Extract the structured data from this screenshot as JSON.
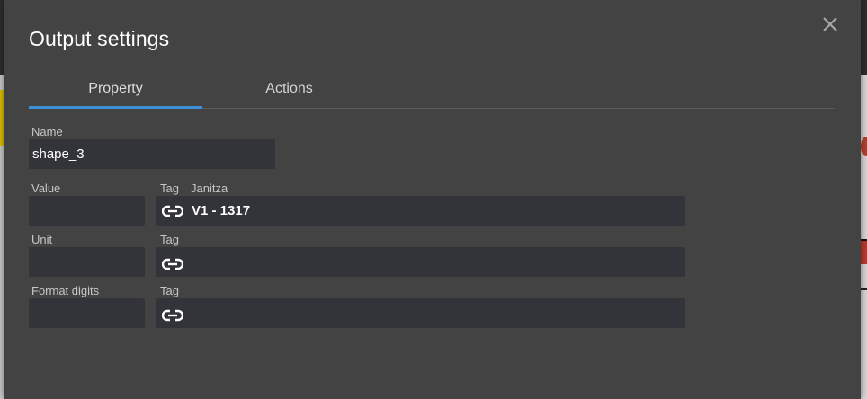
{
  "dialog": {
    "title": "Output settings",
    "close_icon": "close-icon"
  },
  "tabs": [
    {
      "label": "Property",
      "active": true
    },
    {
      "label": "Actions",
      "active": false
    }
  ],
  "accent_color": "#3d8fd6",
  "form": {
    "name": {
      "label": "Name",
      "value": "shape_3"
    },
    "rows": [
      {
        "label": "Value",
        "value": "",
        "tag_label": "Tag",
        "tag_source": "Janitza",
        "tag_value": "V1 - 1317",
        "tag_icon": "link-icon"
      },
      {
        "label": "Unit",
        "value": "",
        "tag_label": "Tag",
        "tag_source": "",
        "tag_value": "",
        "tag_icon": "link-icon"
      },
      {
        "label": "Format digits",
        "value": "",
        "tag_label": "Tag",
        "tag_source": "",
        "tag_value": "",
        "tag_icon": "link-icon"
      }
    ]
  }
}
